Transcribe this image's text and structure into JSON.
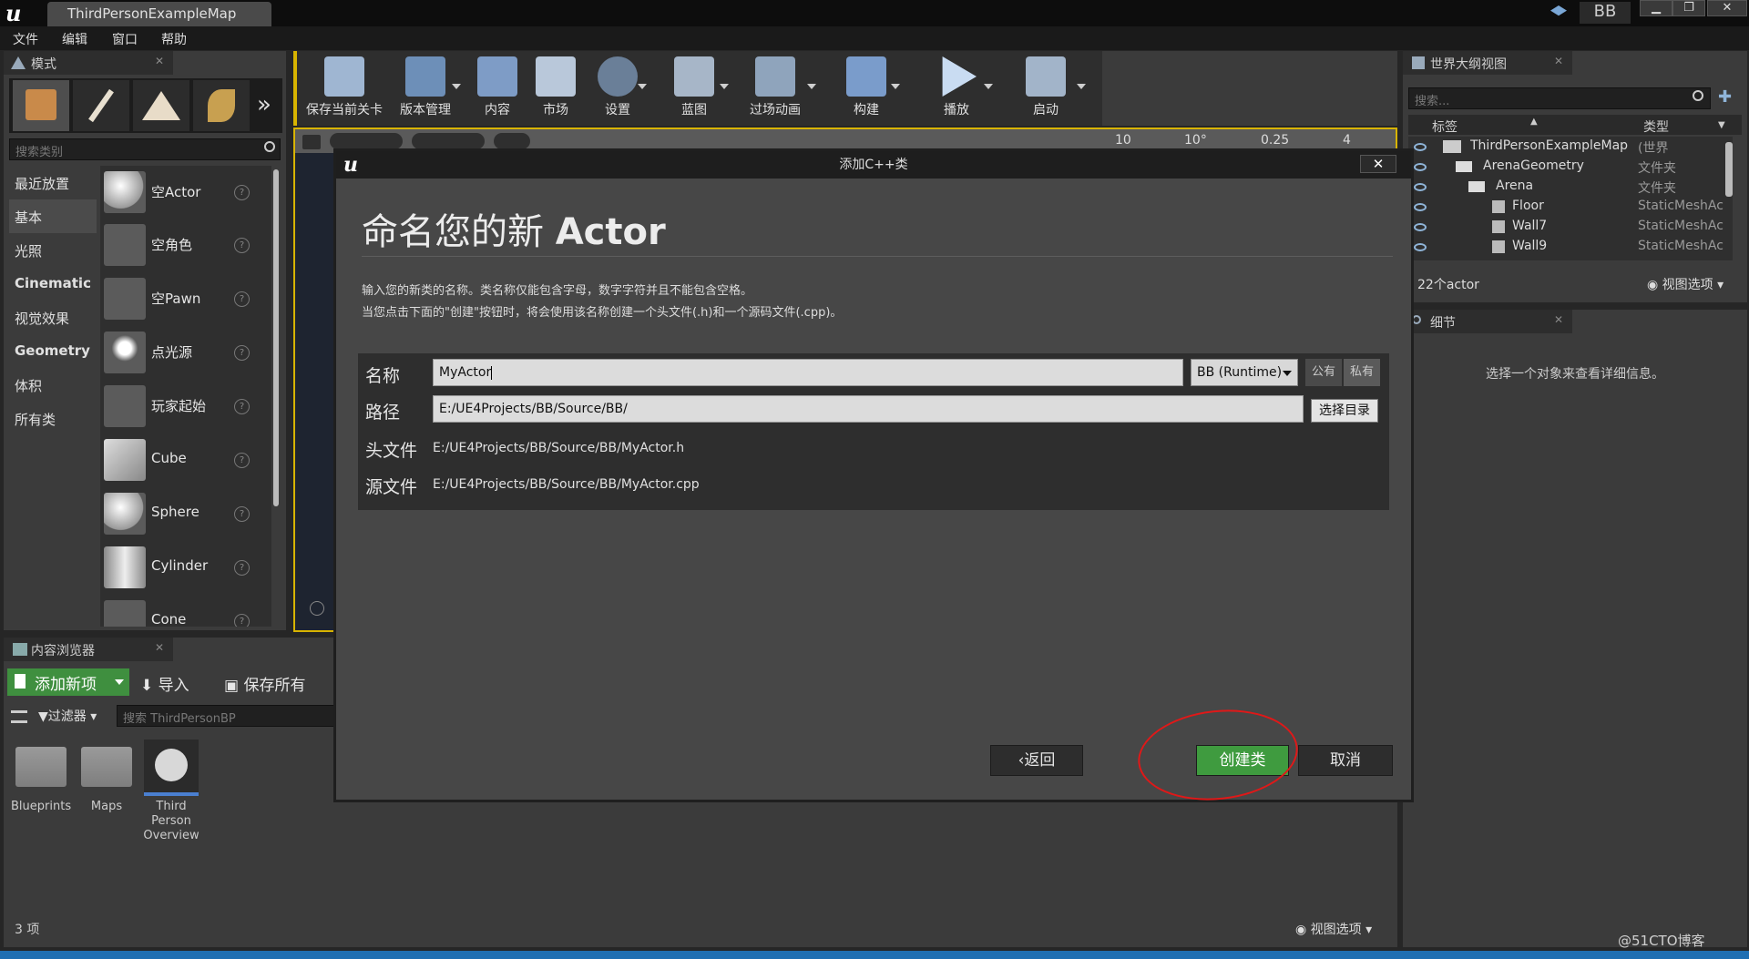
{
  "titlebar": {
    "tab": "ThirdPersonExampleMap",
    "project": "BB",
    "win_min": "▁",
    "win_max": "❐",
    "win_close": "✕"
  },
  "menu": [
    "文件",
    "编辑",
    "窗口",
    "帮助"
  ],
  "modes": {
    "tab": "模式",
    "search_placeholder": "搜索类别",
    "categories": [
      "最近放置",
      "基本",
      "光照",
      "Cinematic",
      "视觉效果",
      "Geometry",
      "体积",
      "所有类"
    ],
    "items": [
      "空Actor",
      "空角色",
      "空Pawn",
      "点光源",
      "玩家起始",
      "Cube",
      "Sphere",
      "Cylinder",
      "Cone"
    ]
  },
  "toolbar": [
    "保存当前关卡",
    "版本管理",
    "内容",
    "市场",
    "设置",
    "蓝图",
    "过场动画",
    "构建",
    "播放",
    "启动"
  ],
  "viewport": {
    "snap_1": "10",
    "snap_2": "10°",
    "snap_3": "0.25",
    "snap_4": "4"
  },
  "dialog": {
    "title": "添加C++类",
    "heading_cn": "命名您的新 ",
    "heading_en": "Actor",
    "desc1": "输入您的新类的名称。类名称仅能包含字母，数字字符并且不能包含空格。",
    "desc2": "当您点击下面的\"创建\"按钮时，将会使用该名称创建一个头文件(.h)和一个源码文件(.cpp)。",
    "name_label": "名称",
    "name_value": "MyActor",
    "module": "BB (Runtime)",
    "public": "公有",
    "private": "私有",
    "path_label": "路径",
    "path_value": "E:/UE4Projects/BB/Source/BB/",
    "choose_dir": "选择目录",
    "header_label": "头文件",
    "header_value": "E:/UE4Projects/BB/Source/BB/MyActor.h",
    "source_label": "源文件",
    "source_value": "E:/UE4Projects/BB/Source/BB/MyActor.cpp",
    "back": "返回",
    "create": "创建类",
    "cancel": "取消"
  },
  "content_browser": {
    "tab": "内容浏览器",
    "add_new": "添加新项",
    "import": "导入",
    "save_all": "保存所有",
    "filters": "过滤器",
    "search_placeholder": "搜索 ThirdPersonBP",
    "assets": [
      "Blueprints",
      "Maps",
      "Third Person Overview"
    ],
    "count": "3 项",
    "view_options": "视图选项"
  },
  "outliner": {
    "tab": "世界大纲视图",
    "search_placeholder": "搜索...",
    "col_label": "标签",
    "col_type": "类型",
    "rows": [
      {
        "label": "ThirdPersonExampleMap",
        "type": "(世界"
      },
      {
        "label": "ArenaGeometry",
        "type": "文件夹"
      },
      {
        "label": "Arena",
        "type": "文件夹"
      },
      {
        "label": "Floor",
        "type": "StaticMeshAc"
      },
      {
        "label": "Wall7",
        "type": "StaticMeshAc"
      },
      {
        "label": "Wall9",
        "type": "StaticMeshAc"
      }
    ],
    "count": "22个actor",
    "view_options": "视图选项"
  },
  "details": {
    "tab": "细节",
    "empty": "选择一个对象来查看详细信息。"
  },
  "watermark": "@51CTO博客"
}
